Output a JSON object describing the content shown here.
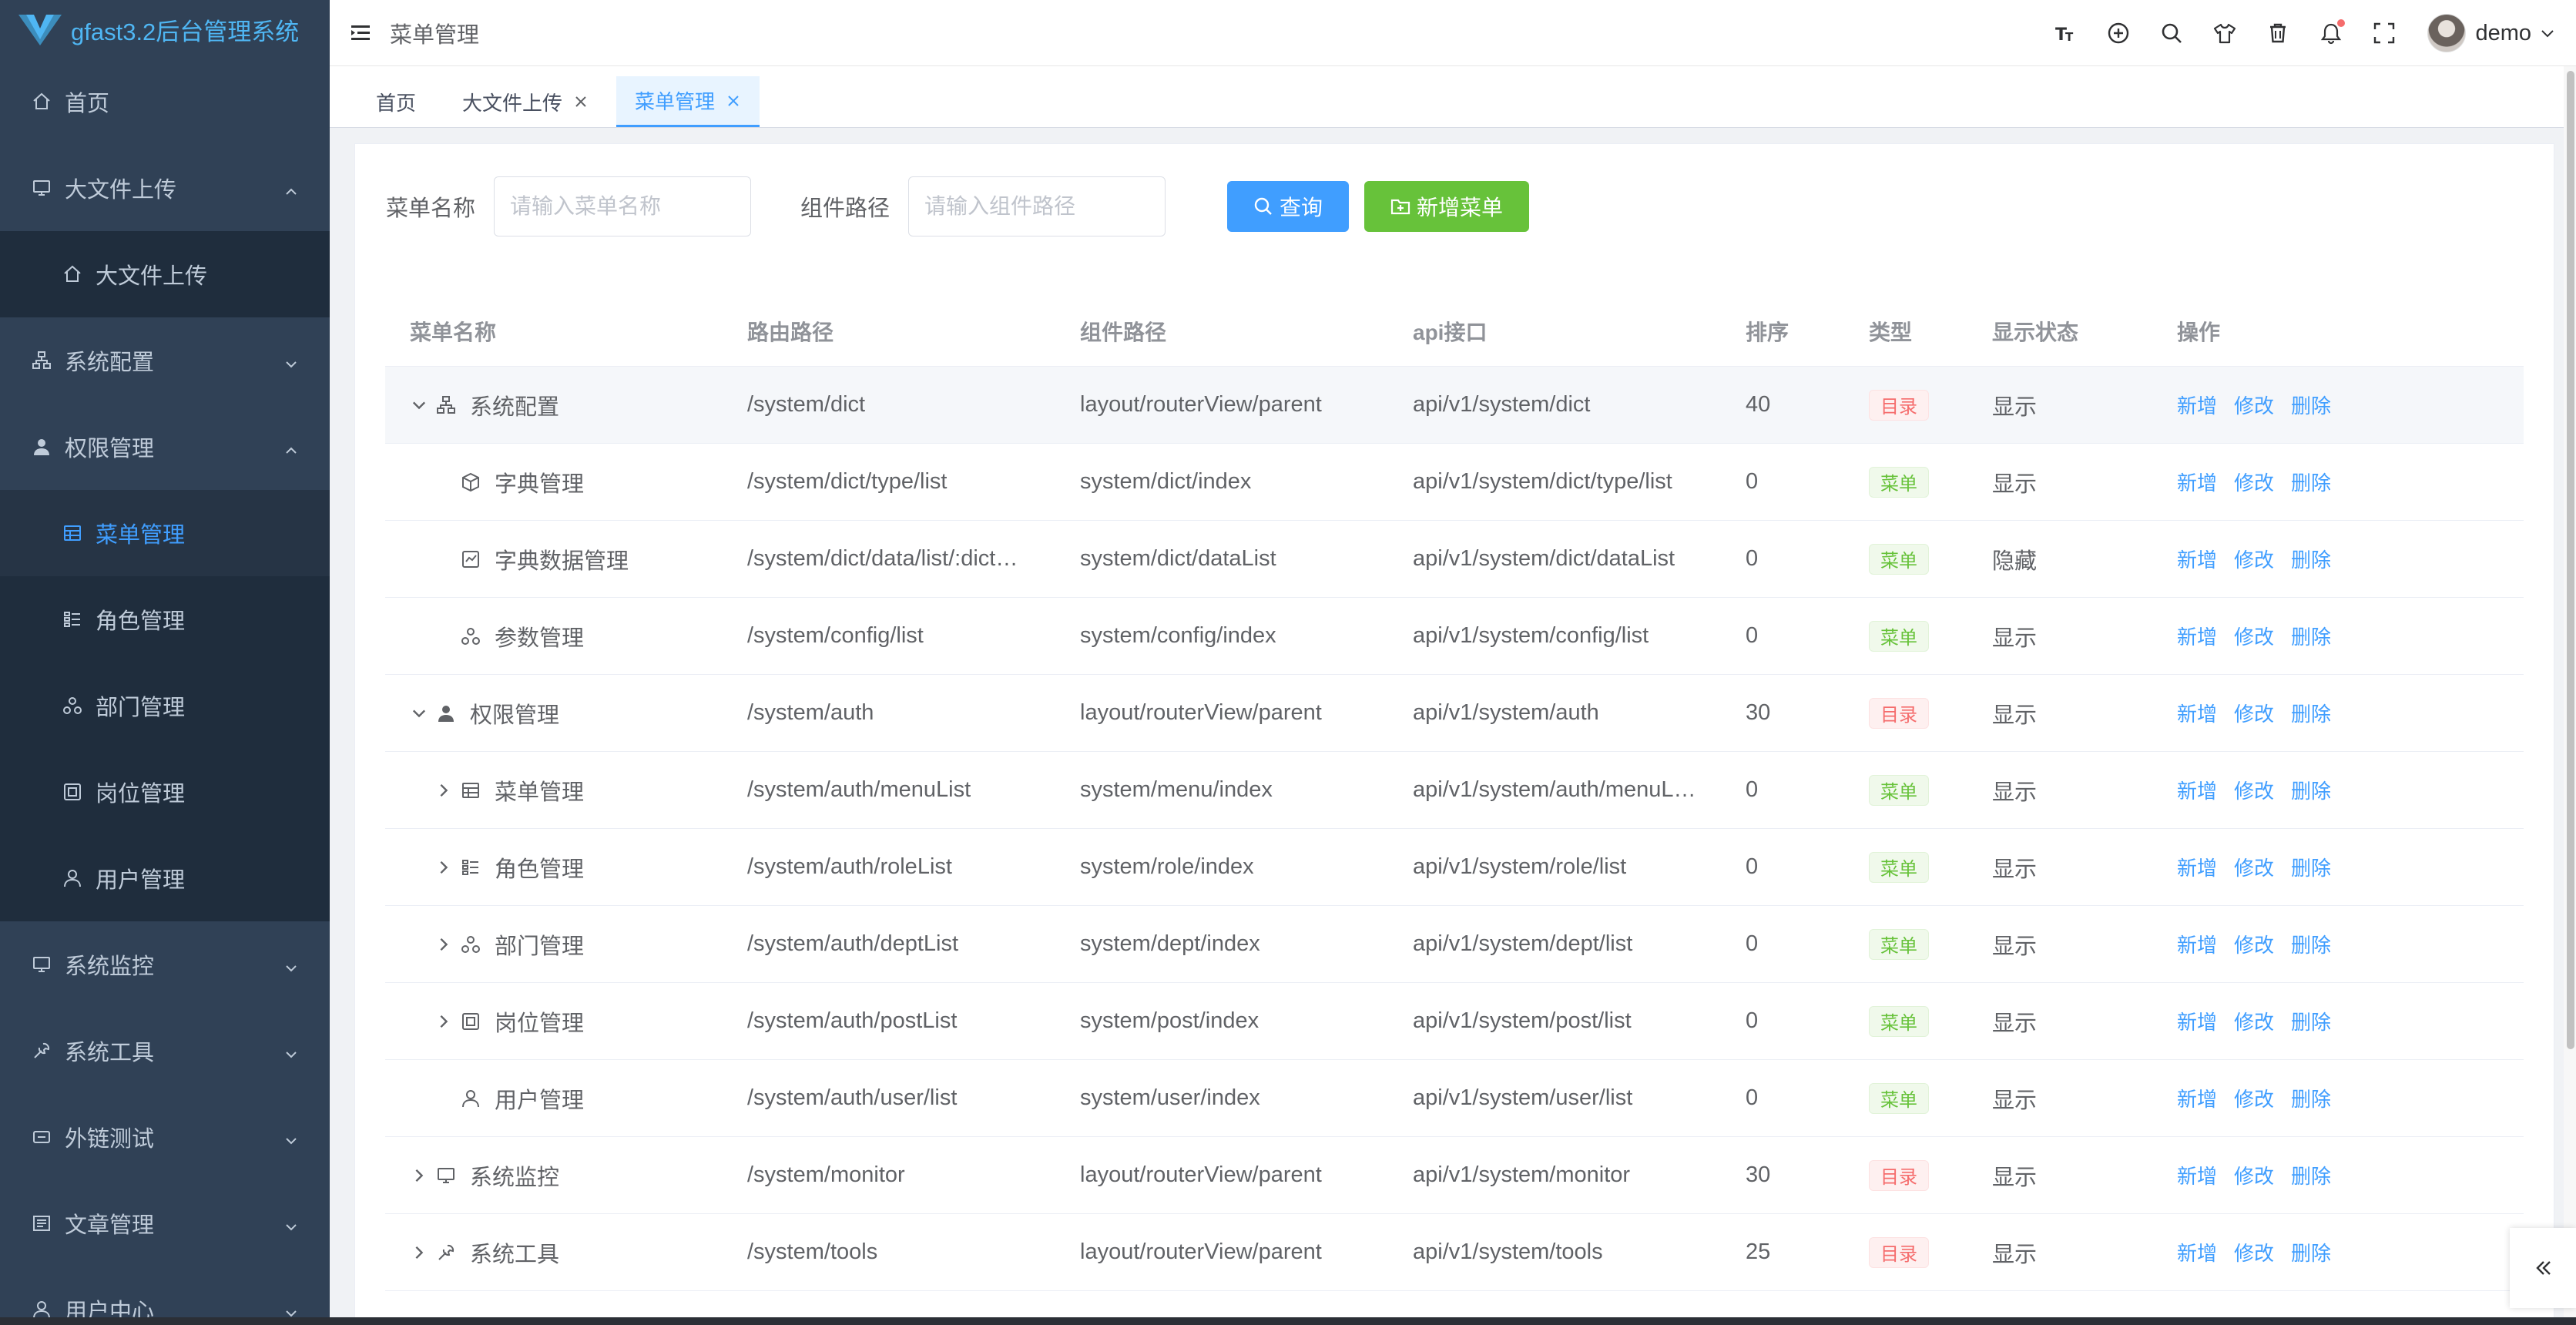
{
  "app": {
    "title": "gfast3.2后台管理系统",
    "brand_color": "#409eff",
    "sidebar_bg": "#304156"
  },
  "sidebar": {
    "items": [
      {
        "label": "首页",
        "icon": "home-icon"
      },
      {
        "label": "大文件上传",
        "icon": "monitor-icon",
        "expanded": true
      },
      {
        "label": "大文件上传",
        "icon": "home-icon",
        "child": true
      },
      {
        "label": "系统配置",
        "icon": "sitemap-icon",
        "expanded": false
      },
      {
        "label": "权限管理",
        "icon": "user-solid-icon",
        "expanded": true
      },
      {
        "label": "菜单管理",
        "icon": "table-icon",
        "child": true,
        "active": true
      },
      {
        "label": "角色管理",
        "icon": "list-icon",
        "child": true
      },
      {
        "label": "部门管理",
        "icon": "tree-icon",
        "child": true
      },
      {
        "label": "岗位管理",
        "icon": "post-icon",
        "child": true
      },
      {
        "label": "用户管理",
        "icon": "user-icon",
        "child": true
      },
      {
        "label": "系统监控",
        "icon": "monitor-icon",
        "expanded": false
      },
      {
        "label": "系统工具",
        "icon": "tool-icon",
        "expanded": false
      },
      {
        "label": "外链测试",
        "icon": "link-icon",
        "expanded": false
      },
      {
        "label": "文章管理",
        "icon": "article-icon",
        "expanded": false
      },
      {
        "label": "用户中心",
        "icon": "user-icon",
        "expanded": false
      }
    ]
  },
  "header": {
    "breadcrumb": "菜单管理",
    "username": "demo",
    "icons": [
      "font-size-icon",
      "plus-circle-icon",
      "search-icon",
      "shirt-icon",
      "trash-icon",
      "bell-icon",
      "fullscreen-icon"
    ]
  },
  "tags": [
    {
      "label": "首页",
      "closable": false,
      "active": false
    },
    {
      "label": "大文件上传",
      "closable": true,
      "active": false
    },
    {
      "label": "菜单管理",
      "closable": true,
      "active": true
    }
  ],
  "search": {
    "name_label": "菜单名称",
    "name_placeholder": "请输入菜单名称",
    "path_label": "组件路径",
    "path_placeholder": "请输入组件路径",
    "query_button": "查询",
    "add_button": "新增菜单"
  },
  "table": {
    "columns": [
      "菜单名称",
      "路由路径",
      "组件路径",
      "api接口",
      "排序",
      "类型",
      "显示状态",
      "操作"
    ],
    "ops": [
      "新增",
      "修改",
      "删除"
    ],
    "rows": [
      {
        "level": 0,
        "expander": "down",
        "icon": "sitemap-icon",
        "name": "系统配置",
        "route": "/system/dict",
        "component": "layout/routerView/parent",
        "api": "api/v1/system/dict",
        "sort": "40",
        "type": "目录",
        "type_kind": "dir",
        "status": "显示",
        "highlight": true
      },
      {
        "level": 1,
        "expander": "none",
        "icon": "cube-icon",
        "name": "字典管理",
        "route": "/system/dict/type/list",
        "component": "system/dict/index",
        "api": "api/v1/system/dict/type/list",
        "sort": "0",
        "type": "菜单",
        "type_kind": "menu",
        "status": "显示"
      },
      {
        "level": 1,
        "expander": "none",
        "icon": "chart-icon",
        "name": "字典数据管理",
        "route": "/system/dict/data/list/:dict…",
        "component": "system/dict/dataList",
        "api": "api/v1/system/dict/dataList",
        "sort": "0",
        "type": "菜单",
        "type_kind": "menu",
        "status": "隐藏"
      },
      {
        "level": 1,
        "expander": "none",
        "icon": "tree-icon",
        "name": "参数管理",
        "route": "/system/config/list",
        "component": "system/config/index",
        "api": "api/v1/system/config/list",
        "sort": "0",
        "type": "菜单",
        "type_kind": "menu",
        "status": "显示"
      },
      {
        "level": 0,
        "expander": "down",
        "icon": "user-solid-icon",
        "name": "权限管理",
        "route": "/system/auth",
        "component": "layout/routerView/parent",
        "api": "api/v1/system/auth",
        "sort": "30",
        "type": "目录",
        "type_kind": "dir",
        "status": "显示"
      },
      {
        "level": 1,
        "expander": "right",
        "icon": "table-icon",
        "name": "菜单管理",
        "route": "/system/auth/menuList",
        "component": "system/menu/index",
        "api": "api/v1/system/auth/menuL…",
        "sort": "0",
        "type": "菜单",
        "type_kind": "menu",
        "status": "显示"
      },
      {
        "level": 1,
        "expander": "right",
        "icon": "list-icon",
        "name": "角色管理",
        "route": "/system/auth/roleList",
        "component": "system/role/index",
        "api": "api/v1/system/role/list",
        "sort": "0",
        "type": "菜单",
        "type_kind": "menu",
        "status": "显示"
      },
      {
        "level": 1,
        "expander": "right",
        "icon": "tree-icon",
        "name": "部门管理",
        "route": "/system/auth/deptList",
        "component": "system/dept/index",
        "api": "api/v1/system/dept/list",
        "sort": "0",
        "type": "菜单",
        "type_kind": "menu",
        "status": "显示"
      },
      {
        "level": 1,
        "expander": "right",
        "icon": "post-icon",
        "name": "岗位管理",
        "route": "/system/auth/postList",
        "component": "system/post/index",
        "api": "api/v1/system/post/list",
        "sort": "0",
        "type": "菜单",
        "type_kind": "menu",
        "status": "显示"
      },
      {
        "level": 1,
        "expander": "none",
        "icon": "user-icon",
        "name": "用户管理",
        "route": "/system/auth/user/list",
        "component": "system/user/index",
        "api": "api/v1/system/user/list",
        "sort": "0",
        "type": "菜单",
        "type_kind": "menu",
        "status": "显示"
      },
      {
        "level": 0,
        "expander": "right",
        "icon": "monitor-icon",
        "name": "系统监控",
        "route": "/system/monitor",
        "component": "layout/routerView/parent",
        "api": "api/v1/system/monitor",
        "sort": "30",
        "type": "目录",
        "type_kind": "dir",
        "status": "显示"
      },
      {
        "level": 0,
        "expander": "right",
        "icon": "tool-icon",
        "name": "系统工具",
        "route": "/system/tools",
        "component": "layout/routerView/parent",
        "api": "api/v1/system/tools",
        "sort": "25",
        "type": "目录",
        "type_kind": "dir",
        "status": "显示"
      }
    ]
  }
}
